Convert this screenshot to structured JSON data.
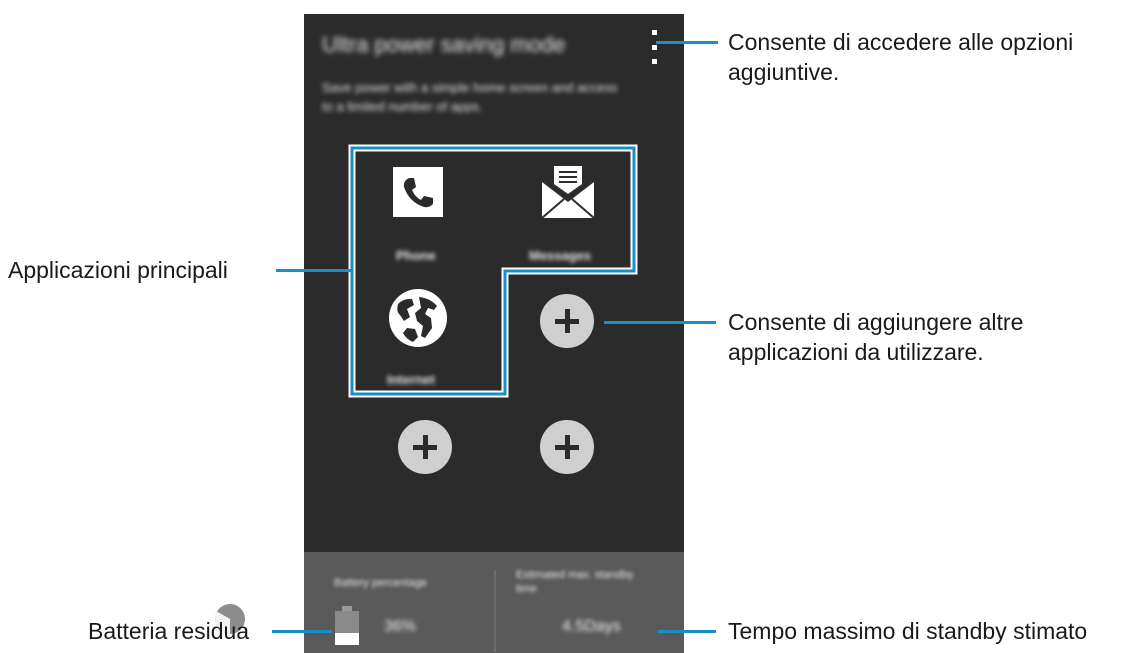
{
  "screen": {
    "title": "Ultra power saving mode",
    "description": "Save power with a simple home screen and access to a limited number of apps.",
    "apps": [
      {
        "label": "Phone",
        "icon": "phone-icon"
      },
      {
        "label": "Messages",
        "icon": "envelope-icon"
      },
      {
        "label": "Internet",
        "icon": "globe-icon"
      }
    ],
    "battery": {
      "label": "Battery percentage",
      "value": "36%",
      "level": 0.36
    },
    "standby": {
      "label": "Estimated max. standby time",
      "value": "4.5Days"
    }
  },
  "callouts": {
    "options": "Consente di accedere alle opzioni aggiuntive.",
    "main_apps": "Applicazioni principali",
    "add_apps": "Consente di aggiungere altre applicazioni da utilizzare.",
    "battery": "Batteria residua",
    "standby": "Tempo massimo di standby stimato"
  },
  "colors": {
    "accent": "#1a8fc7",
    "screen_bg": "#2b2b2b",
    "bottom_bar": "#5a5a5a"
  }
}
